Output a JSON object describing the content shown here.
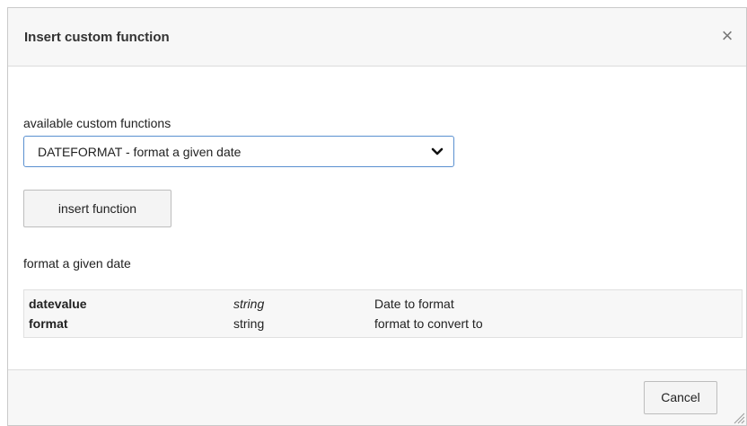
{
  "dialog": {
    "title": "Insert custom function",
    "close_glyph": "×"
  },
  "form": {
    "label": "available custom functions",
    "selected": "DATEFORMAT - format a given date",
    "insert_label": "insert function",
    "description": "format a given date"
  },
  "params": [
    {
      "name": "datevalue",
      "type": "string",
      "type_italic": true,
      "desc": "Date to format"
    },
    {
      "name": "format",
      "type": "string",
      "type_italic": false,
      "desc": "format to convert to"
    }
  ],
  "footer": {
    "cancel_label": "Cancel"
  },
  "icons": {
    "close": "close-icon",
    "chevron": "chevron-down-icon",
    "resize": "resize-grip-icon"
  },
  "colors": {
    "select_border": "#5a90d0",
    "header_bg": "#f7f7f7"
  }
}
